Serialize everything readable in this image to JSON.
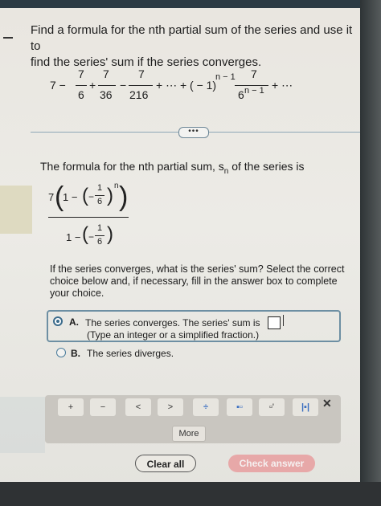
{
  "question": {
    "line1": "Find a formula for the nth partial sum of the series and use it to",
    "line2": "find the series' sum if the series converges."
  },
  "series_expr": {
    "lead": "7 −",
    "f1_num": "7",
    "f1_den": "6",
    "plus1": "+",
    "f2_num": "7",
    "f2_den": "36",
    "minus1": "−",
    "f3_num": "7",
    "f3_den": "216",
    "mid": "+ ⋯ + ( − 1)",
    "exp": "n − 1",
    "f4_num": "7",
    "f4_den": "6",
    "f4_exp": "n − 1",
    "tail": "+ ⋯"
  },
  "expand_dots": "•••",
  "formula_label": {
    "text": "The formula for the nth partial sum, s",
    "sub": "n",
    "rest": " of the series is"
  },
  "formula": {
    "seven": "7",
    "one": "1 −",
    "inner_num": "1",
    "inner_den": "6",
    "neg": "−",
    "power": "n",
    "den_one": "1 −",
    "den_neg": "−",
    "den_num": "1",
    "den_den": "6"
  },
  "question2": {
    "text": "If the series converges, what is the series' sum? Select the correct choice below and, if necessary, fill in the answer box to complete your choice."
  },
  "options": {
    "a_letter": "A.",
    "a_text": "The series converges. The series' sum is",
    "a_hint": "(Type an integer or a simplified fraction.)",
    "b_letter": "B.",
    "b_text": "The series diverges."
  },
  "toolbar": {
    "keys": [
      "+",
      "−",
      "<",
      ">",
      "÷",
      "▪▫",
      "▫'",
      "|▪|"
    ],
    "more": "More",
    "close": "✕"
  },
  "actions": {
    "clear": "Clear all",
    "check": "Check answer"
  }
}
